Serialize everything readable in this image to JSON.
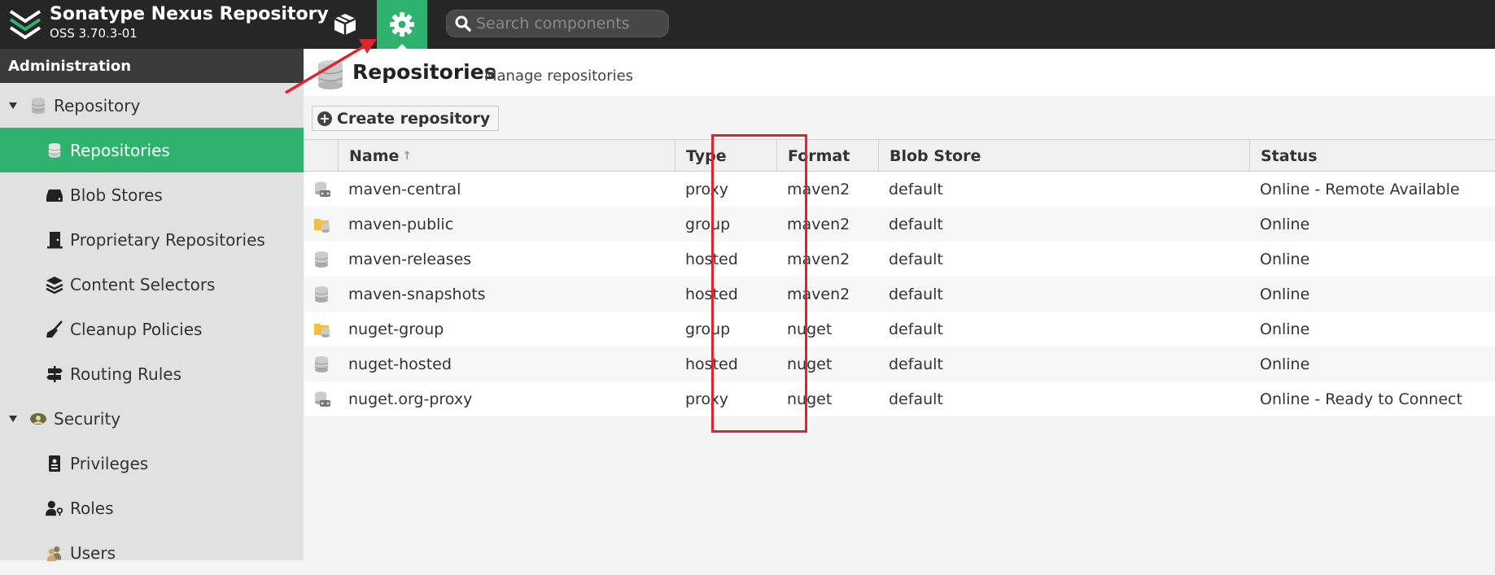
{
  "app": {
    "title": "Sonatype Nexus Repository",
    "version": "OSS 3.70.3-01"
  },
  "header": {
    "browse_icon": "cube-icon",
    "admin_icon": "gear-icon",
    "search_placeholder": "Search components"
  },
  "sidebar": {
    "heading": "Administration",
    "items": [
      {
        "label": "Repository",
        "icon": "database-icon",
        "level": "group",
        "expanded": true
      },
      {
        "label": "Repositories",
        "icon": "database-icon",
        "level": "child",
        "selected": true
      },
      {
        "label": "Blob Stores",
        "icon": "hard-drive-icon",
        "level": "child"
      },
      {
        "label": "Proprietary Repositories",
        "icon": "door-icon",
        "level": "child"
      },
      {
        "label": "Content Selectors",
        "icon": "layers-icon",
        "level": "child"
      },
      {
        "label": "Cleanup Policies",
        "icon": "broom-icon",
        "level": "child"
      },
      {
        "label": "Routing Rules",
        "icon": "signpost-icon",
        "level": "child"
      },
      {
        "label": "Security",
        "icon": "badge-icon",
        "level": "group",
        "expanded": true
      },
      {
        "label": "Privileges",
        "icon": "id-card-icon",
        "level": "child"
      },
      {
        "label": "Roles",
        "icon": "user-key-icon",
        "level": "child"
      },
      {
        "label": "Users",
        "icon": "users-icon",
        "level": "child"
      }
    ]
  },
  "main": {
    "title": "Repositories",
    "subtitle": "Manage repositories",
    "create_label": "Create repository",
    "columns": [
      "Name",
      "Type",
      "Format",
      "Blob Store",
      "Status"
    ],
    "rows": [
      {
        "name": "maven-central",
        "type": "proxy",
        "format": "maven2",
        "blob": "default",
        "status": "Online - Remote Available"
      },
      {
        "name": "maven-public",
        "type": "group",
        "format": "maven2",
        "blob": "default",
        "status": "Online"
      },
      {
        "name": "maven-releases",
        "type": "hosted",
        "format": "maven2",
        "blob": "default",
        "status": "Online"
      },
      {
        "name": "maven-snapshots",
        "type": "hosted",
        "format": "maven2",
        "blob": "default",
        "status": "Online"
      },
      {
        "name": "nuget-group",
        "type": "group",
        "format": "nuget",
        "blob": "default",
        "status": "Online"
      },
      {
        "name": "nuget-hosted",
        "type": "hosted",
        "format": "nuget",
        "blob": "default",
        "status": "Online"
      },
      {
        "name": "nuget.org-proxy",
        "type": "proxy",
        "format": "nuget",
        "blob": "default",
        "status": "Online - Ready to Connect"
      }
    ]
  },
  "colors": {
    "header_bg": "#262626",
    "accent": "#2fb26e",
    "annotation": "#e0242e"
  }
}
